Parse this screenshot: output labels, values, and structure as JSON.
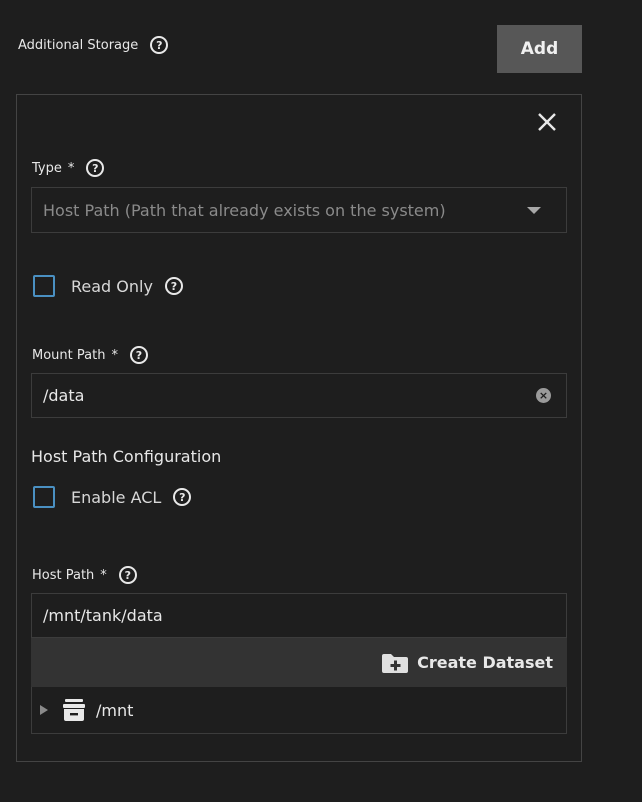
{
  "section": {
    "title": "Additional Storage",
    "add_label": "Add"
  },
  "type_field": {
    "label": "Type",
    "required_mark": "*",
    "value": "Host Path (Path that already exists on the system)"
  },
  "read_only": {
    "label": "Read Only",
    "checked": false
  },
  "mount_path": {
    "label": "Mount Path",
    "required_mark": "*",
    "value": "/data"
  },
  "host_path_config": {
    "title": "Host Path Configuration"
  },
  "enable_acl": {
    "label": "Enable ACL",
    "checked": false
  },
  "host_path": {
    "label": "Host Path",
    "required_mark": "*",
    "value": "/mnt/tank/data",
    "create_dataset_label": "Create Dataset",
    "tree": [
      {
        "label": "/mnt"
      }
    ]
  },
  "icons": {
    "help": "help-icon",
    "close": "close-icon",
    "dropdown": "chevron-down-icon",
    "clear": "clear-icon",
    "folder_plus": "folder-plus-icon",
    "dataset": "dataset-icon",
    "expand": "expand-arrow-icon"
  },
  "colors": {
    "background": "#1e1e1e",
    "button": "#575757",
    "checkbox_border": "#4a90c2",
    "field_border": "#3c3c3c"
  }
}
